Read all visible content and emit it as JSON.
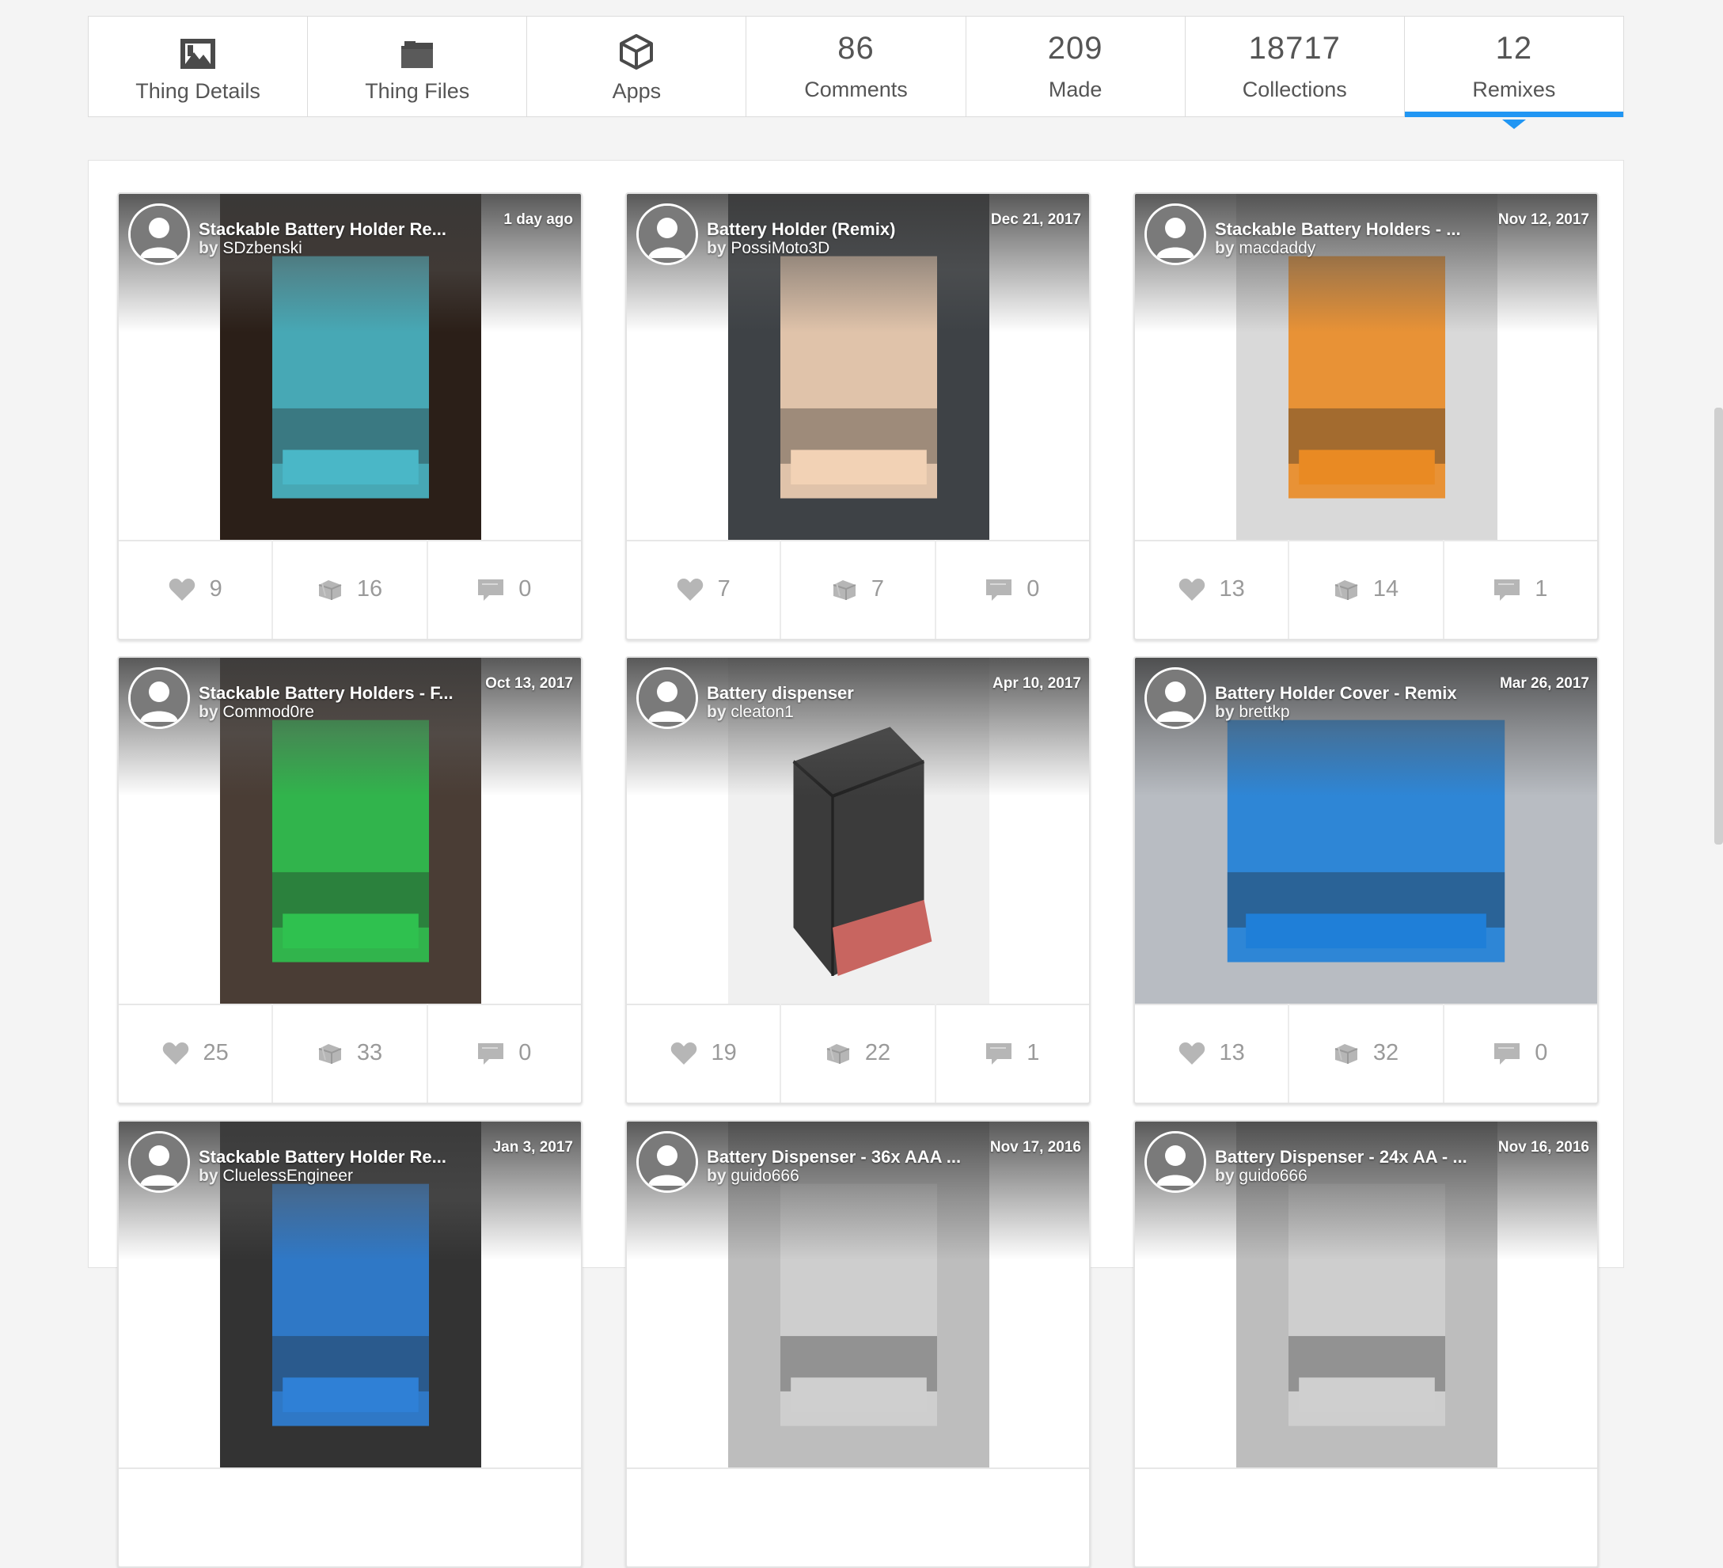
{
  "tabs": [
    {
      "icon": "thing-details-icon",
      "label": "Thing Details",
      "count": ""
    },
    {
      "icon": "folder-icon",
      "label": "Thing Files",
      "count": ""
    },
    {
      "icon": "cube-icon",
      "label": "Apps",
      "count": ""
    },
    {
      "icon": "",
      "label": "Comments",
      "count": "86"
    },
    {
      "icon": "",
      "label": "Made",
      "count": "209"
    },
    {
      "icon": "",
      "label": "Collections",
      "count": "18717"
    },
    {
      "icon": "",
      "label": "Remixes",
      "count": "12",
      "active": true
    }
  ],
  "by_prefix": "by",
  "cards": [
    {
      "title": "Stackable Battery Holder Re...",
      "author": "SDzbenski",
      "date": "1 day ago",
      "likes": "9",
      "collects": "16",
      "comments": "0",
      "model_color": "#4ab7c7",
      "photo_bg": "#2b1f18"
    },
    {
      "title": "Battery Holder (Remix)",
      "author": "PossiMoto3D",
      "date": "Dec 21, 2017",
      "likes": "7",
      "collects": "7",
      "comments": "0",
      "model_color": "#f2d2b5",
      "photo_bg": "#3e4246"
    },
    {
      "title": "Stackable Battery Holders - ...",
      "author": "macdaddy",
      "date": "Nov 12, 2017",
      "likes": "13",
      "collects": "14",
      "comments": "1",
      "model_color": "#e98a23",
      "photo_bg": "#d9d9d9"
    },
    {
      "title": "Stackable Battery Holders - F...",
      "author": "Commod0re",
      "date": "Oct 13, 2017",
      "likes": "25",
      "collects": "33",
      "comments": "0",
      "model_color": "#2fc14f",
      "photo_bg": "#4a3d35"
    },
    {
      "title": "Battery dispenser",
      "author": "cleaton1",
      "date": "Apr 10, 2017",
      "likes": "19",
      "collects": "22",
      "comments": "1",
      "model_color": "#3b3b3b",
      "photo_bg": "#f0f0f0"
    },
    {
      "title": "Battery Holder Cover - Remix",
      "author": "brettkp",
      "date": "Mar 26, 2017",
      "likes": "13",
      "collects": "32",
      "comments": "0",
      "model_color": "#1f7fd8",
      "photo_bg": "#b8bcc2"
    },
    {
      "title": "Stackable Battery Holder Re...",
      "author": "CluelessEngineer",
      "date": "Jan 3, 2017",
      "likes": "",
      "collects": "",
      "comments": "",
      "model_color": "#2f80d6",
      "photo_bg": "#333"
    },
    {
      "title": "Battery Dispenser - 36x AAA ...",
      "author": "guido666",
      "date": "Nov 17, 2016",
      "likes": "",
      "collects": "",
      "comments": "",
      "model_color": "#cfcfcf",
      "photo_bg": "#bdbdbd"
    },
    {
      "title": "Battery Dispenser - 24x AA - ...",
      "author": "guido666",
      "date": "Nov 16, 2016",
      "likes": "",
      "collects": "",
      "comments": "",
      "model_color": "#cfcfcf",
      "photo_bg": "#bdbdbd"
    }
  ]
}
